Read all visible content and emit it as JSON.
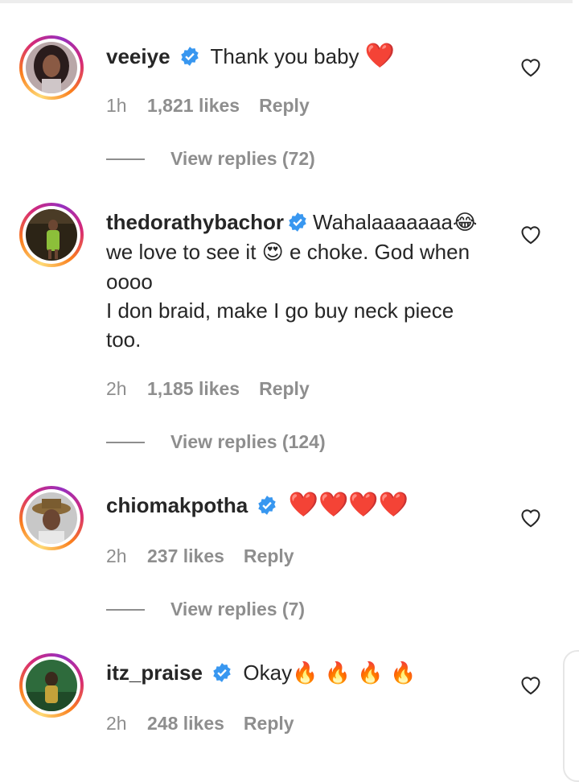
{
  "comments": [
    {
      "username": "veeiye",
      "text_lines": [
        "Thank you baby"
      ],
      "trailing_emoji": "❤️",
      "time": "1h",
      "likes": "1,821 likes",
      "reply": "Reply",
      "view_replies": "View replies (72)"
    },
    {
      "username": "thedorathybachor",
      "line1_text": "Wahalaaaaaaa",
      "line1_emoji": "😂",
      "line2_a": "we love to see it",
      "line2_emoji": "😍",
      "line2_b": "e choke. God when",
      "line3": "oooo",
      "line4": "I don braid, make I go buy neck piece",
      "line5": "too.",
      "time": "2h",
      "likes": "1,185 likes",
      "reply": "Reply",
      "view_replies": "View replies (124)"
    },
    {
      "username": "chiomakpotha",
      "hearts": "❤️❤️❤️❤️",
      "time": "2h",
      "likes": "237 likes",
      "reply": "Reply",
      "view_replies": "View replies (7)"
    },
    {
      "username": "itz_praise",
      "text": "Okay",
      "fires": "🔥 🔥 🔥 🔥",
      "time": "2h",
      "likes": "248 likes",
      "reply": "Reply"
    }
  ],
  "icons": {
    "verified": "verified-badge-icon",
    "like": "heart-outline-icon"
  },
  "colors": {
    "verified": "#3897f0",
    "muted": "#8e8e8e",
    "text": "#262626",
    "heart": "#e0102e"
  }
}
